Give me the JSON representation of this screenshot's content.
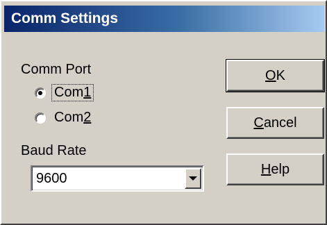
{
  "window": {
    "title": "Comm Settings"
  },
  "comm_port": {
    "label": "Comm Port",
    "options": [
      {
        "label_pre": "Com",
        "label_acc": "1",
        "selected": true
      },
      {
        "label_pre": "Com",
        "label_acc": "2",
        "selected": false
      }
    ]
  },
  "baud_rate": {
    "label": "Baud Rate",
    "value": "9600"
  },
  "buttons": {
    "ok": {
      "acc": "O",
      "rest": "K"
    },
    "cancel": {
      "acc": "C",
      "rest": "ancel"
    },
    "help": {
      "acc": "H",
      "rest": "elp"
    }
  },
  "colors": {
    "face": "#d4d0c8",
    "title_start": "#0a246a",
    "title_end": "#a6caf0"
  }
}
